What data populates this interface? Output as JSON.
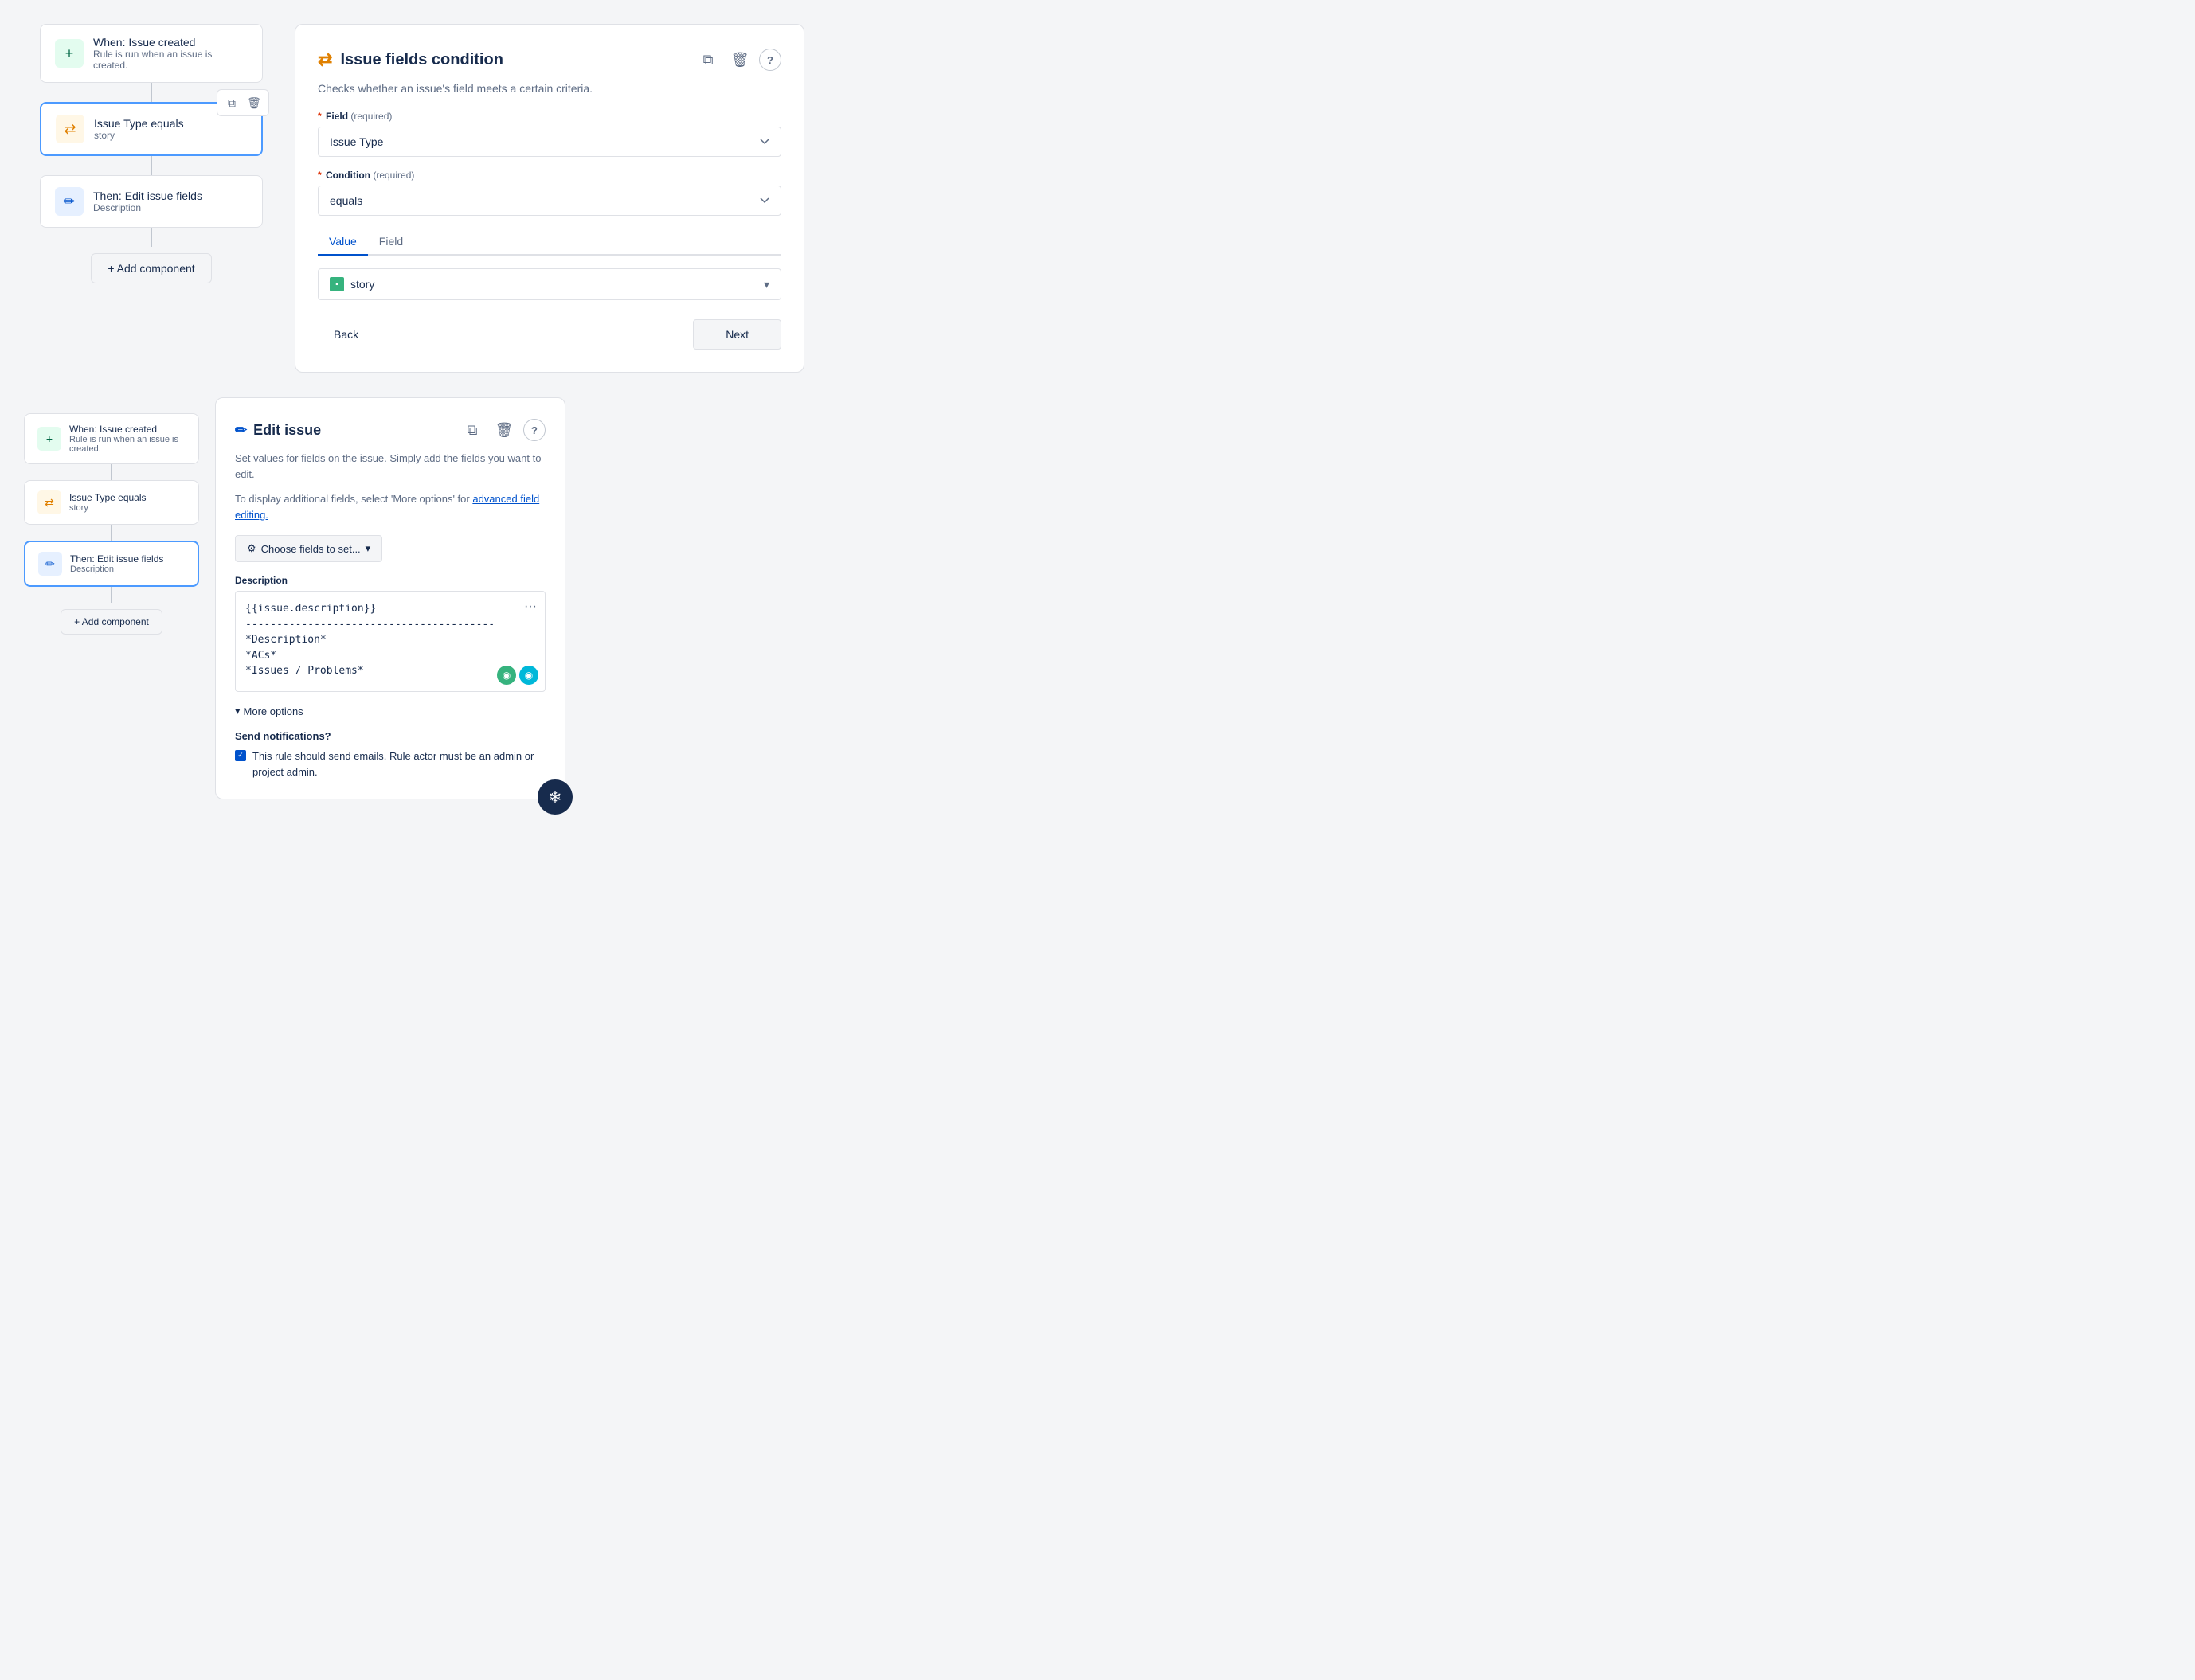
{
  "top": {
    "workflow": {
      "node1": {
        "title": "When: Issue created",
        "subtitle": "Rule is run when an issue is created."
      },
      "node2": {
        "title": "Issue Type equals",
        "subtitle": "story"
      },
      "node3": {
        "title": "Then: Edit issue fields",
        "subtitle": "Description"
      },
      "add_label": "+ Add component"
    },
    "condition_panel": {
      "title": "Issue fields condition",
      "description": "Checks whether an issue's field meets a certain criteria.",
      "field_label": "Field",
      "required_hint": "(required)",
      "field_value": "Issue Type",
      "condition_label": "Condition",
      "condition_value": "equals",
      "tab_value": "Value",
      "tab_field": "Field",
      "story_value": "story",
      "back_label": "Back",
      "next_label": "Next"
    }
  },
  "bottom": {
    "workflow": {
      "node1": {
        "title": "When: Issue created",
        "subtitle": "Rule is run when an issue is created."
      },
      "node2": {
        "title": "Issue Type equals",
        "subtitle": "story"
      },
      "node3": {
        "title": "Then: Edit issue fields",
        "subtitle": "Description"
      },
      "add_label": "+ Add component"
    },
    "edit_panel": {
      "title": "Edit issue",
      "description": "Set values for fields on the issue. Simply add the fields you want to edit.",
      "note_prefix": "To display additional fields, select 'More options' for ",
      "note_link": "advanced field editing.",
      "choose_fields_label": "Choose fields to set...",
      "description_label": "Description",
      "description_value": "{{issue.description}}\n----------------------------------------\n*Description*\n*ACs*\n*Issues / Problems*",
      "more_options_label": "More options",
      "send_notifications_label": "Send notifications?",
      "notification_text": "This rule should send emails. Rule actor must be an admin or project admin."
    }
  },
  "icons": {
    "shuffle": "⇄",
    "pencil": "✏",
    "plus": "+",
    "copy": "⧉",
    "trash": "🗑",
    "question": "?",
    "gear": "⚙",
    "chevron_down": "▾",
    "ellipsis": "···",
    "check": "✓",
    "snowflake": "❄"
  }
}
